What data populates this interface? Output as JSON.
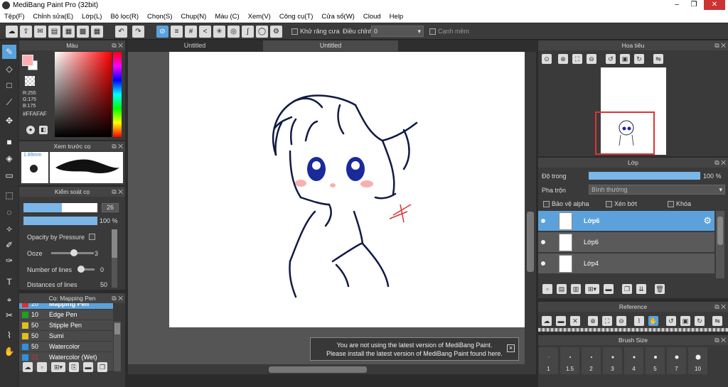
{
  "window": {
    "title": "MediBang Paint Pro (32bit)"
  },
  "menu": [
    "Tệp(F)",
    "Chỉnh sửa(E)",
    "Lớp(L)",
    "Bộ lọc(R)",
    "Chọn(S)",
    "Chụp(N)",
    "Màu (C)",
    "Xem(V)",
    "Công cụ(T)",
    "Cửa số(W)",
    "Cloud",
    "Help"
  ],
  "toolbar": {
    "antialias_label": "Khử răng cưa",
    "adjust_label": "Điều chỉnh",
    "adjust_value": "0",
    "edge_label": "Cạnh mềm"
  },
  "tabs": [
    "Untitled",
    "Untitled"
  ],
  "color_panel": {
    "title": "Màu",
    "r": "R:255",
    "g": "G:175",
    "b": "B:175",
    "hex": "#FFAFAF",
    "primary_color": "#FFAFAF"
  },
  "preview_panel": {
    "title": "Xem trước cọ",
    "size": "1.89mm"
  },
  "brush_control": {
    "title": "Kiểm soát cọ",
    "size_value": "26",
    "opacity_value": "100 %",
    "opacity_pressure_label": "Opacity by Pressure",
    "ooze_label": "Ooze",
    "ooze_value": "3",
    "lines_label": "Number of lines",
    "lines_value": "0",
    "distance_label": "Distances of lines",
    "distance_value": "50"
  },
  "brush_list": {
    "title": "Cọ: Mapping Pen",
    "items": [
      {
        "num": "20",
        "name": "Mapping Pen",
        "color": "#e03030"
      },
      {
        "num": "10",
        "name": "Edge Pen",
        "color": "#20a020"
      },
      {
        "num": "50",
        "name": "Stipple Pen",
        "color": "#e0c020"
      },
      {
        "num": "50",
        "name": "Sumi",
        "color": "#e0c020"
      },
      {
        "num": "50",
        "name": "Watercolor",
        "color": "#3090e0"
      },
      {
        "num": "21",
        "name": "Watercolor (Wet)",
        "color": "#3090e0"
      }
    ]
  },
  "navigator": {
    "title": "Hoa tiêu"
  },
  "layers": {
    "title": "Lớp",
    "opacity_label": "Độ trong",
    "opacity_value": "100 %",
    "blend_label": "Pha trộn",
    "blend_value": "Bình thường",
    "protect_alpha": "Bảo vệ alpha",
    "clip": "Xén bớt",
    "lock": "Khóa",
    "items": [
      "Lớp6",
      "Lớp6",
      "Lớp4"
    ]
  },
  "reference": {
    "title": "Reference"
  },
  "brush_size": {
    "title": "Brush Size",
    "sizes": [
      "1",
      "1.5",
      "2",
      "3",
      "4",
      "5",
      "7",
      "10"
    ]
  },
  "notice": {
    "line1": "You are not using the latest version of MediBang Paint.",
    "line2": "Please install the latest version of MediBang Paint found here.",
    "close": "×"
  }
}
